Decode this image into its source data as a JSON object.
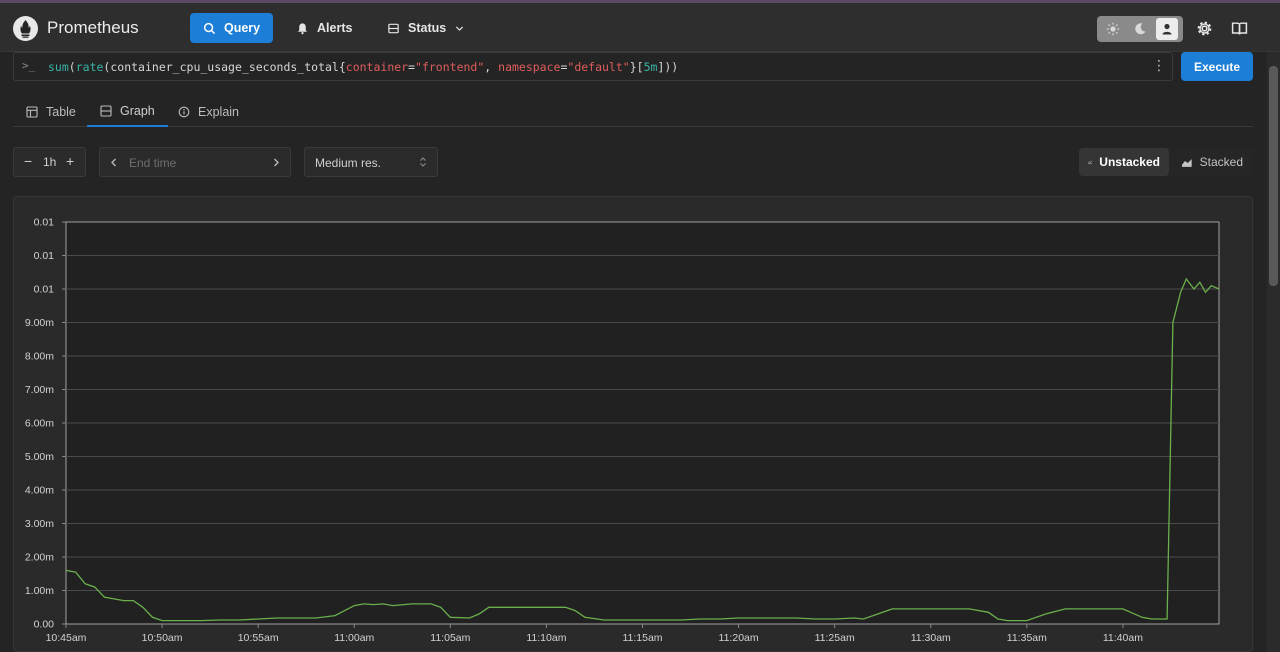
{
  "app": {
    "title": "Prometheus"
  },
  "nav": {
    "query": "Query",
    "alerts": "Alerts",
    "status": "Status"
  },
  "query": {
    "prompt": ">_",
    "parts": {
      "fn1": "sum",
      "p1": "(",
      "fn2": "rate",
      "p2": "(",
      "metric": "container_cpu_usage_seconds_total",
      "b1": "{",
      "label1": "container",
      "eq1": "=",
      "val1": "\"frontend\"",
      "comma": ", ",
      "label2": "namespace",
      "eq2": "=",
      "val2": "\"default\"",
      "b2": "}",
      "r1": "[",
      "dur": "5m",
      "r2": "]",
      "p3": "))"
    },
    "execute_label": "Execute"
  },
  "tabs": {
    "table": "Table",
    "graph": "Graph",
    "explain": "Explain"
  },
  "controls": {
    "range_minus": "−",
    "range": "1h",
    "range_plus": "+",
    "end_time_placeholder": "End time",
    "resolution": "Medium res.",
    "unstacked": "Unstacked",
    "stacked": "Stacked"
  },
  "colors": {
    "accent": "#1c7ed6",
    "series": "#6ab04c"
  },
  "chart_data": {
    "type": "line",
    "y_tick_labels": [
      "0.00",
      "1.00m",
      "2.00m",
      "3.00m",
      "4.00m",
      "5.00m",
      "6.00m",
      "7.00m",
      "8.00m",
      "9.00m",
      "0.01",
      "0.01",
      "0.01"
    ],
    "x_tick_labels": [
      "10:45am",
      "10:50am",
      "10:55am",
      "11:00am",
      "11:05am",
      "11:10am",
      "11:15am",
      "11:20am",
      "11:25am",
      "11:30am",
      "11:35am",
      "11:40am"
    ],
    "x_unit": "minutes",
    "xlim": [
      0,
      60
    ],
    "ylim": [
      0,
      0.012
    ],
    "grid": true,
    "series": [
      {
        "x": [
          0,
          0.5,
          1,
          1.5,
          2,
          2.5,
          3,
          3.5,
          4,
          4.5,
          5,
          5.5,
          6,
          7,
          8,
          9,
          10,
          11,
          12,
          13,
          14,
          15,
          15.5,
          16,
          16.5,
          17,
          18,
          19,
          19.5,
          20,
          21,
          21.5,
          22,
          23,
          24,
          25,
          26,
          26.5,
          27,
          28,
          29,
          30,
          31,
          32,
          33,
          34,
          35,
          36,
          37,
          38,
          39,
          40,
          41,
          41.5,
          42,
          43,
          44,
          45,
          46,
          47,
          48,
          48.5,
          49,
          50,
          51,
          52,
          53,
          53.5,
          54,
          55,
          56,
          56.5,
          56.8,
          57,
          57.3,
          57.6,
          58,
          58.3,
          58.7,
          59,
          59.3,
          59.6,
          60
        ],
        "y": [
          0.0016,
          0.00155,
          0.0012,
          0.0011,
          0.0008,
          0.00075,
          0.0007,
          0.0007,
          0.0005,
          0.0002,
          0.0001,
          0.0001,
          0.0001,
          0.0001,
          0.00012,
          0.00012,
          0.00015,
          0.00018,
          0.00018,
          0.00018,
          0.00025,
          0.00055,
          0.0006,
          0.00058,
          0.0006,
          0.00055,
          0.0006,
          0.0006,
          0.0005,
          0.0002,
          0.00018,
          0.0003,
          0.0005,
          0.0005,
          0.0005,
          0.0005,
          0.0005,
          0.0004,
          0.0002,
          0.00012,
          0.00012,
          0.00012,
          0.00012,
          0.00012,
          0.00015,
          0.00015,
          0.00018,
          0.00018,
          0.00018,
          0.00018,
          0.00015,
          0.00015,
          0.00018,
          0.00015,
          0.00025,
          0.00045,
          0.00045,
          0.00045,
          0.00045,
          0.00045,
          0.00035,
          0.00015,
          0.0001,
          0.0001,
          0.0003,
          0.00045,
          0.00045,
          0.00045,
          0.00045,
          0.00045,
          0.0002,
          0.00015,
          0.00015,
          0.00015,
          0.00015,
          0.009,
          0.0099,
          0.0103,
          0.01,
          0.0102,
          0.0099,
          0.0101,
          0.01
        ]
      }
    ]
  }
}
